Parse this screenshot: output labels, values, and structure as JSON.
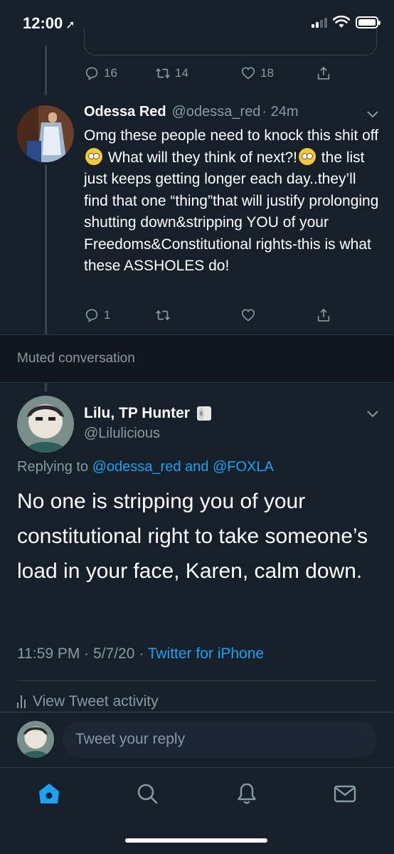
{
  "status_bar": {
    "time": "12:00"
  },
  "previous_tweet_actions": {
    "replies": "16",
    "retweets": "14",
    "likes": "18"
  },
  "reply_tweet": {
    "name": "Odessa Red",
    "handle": "@odessa_red",
    "time": "· 24m",
    "text_1": "Omg these people need to knock this shit off",
    "text_2": " What will they think of next?!",
    "text_3": " the list just keeps getting longer each day..they’ll find that one “thing”that will justify prolonging shutting down&stripping YOU of your Freedoms&Constitutional rights-this is what these ASSHOLES do!",
    "replies": "1"
  },
  "muted_label": "Muted conversation",
  "main_tweet": {
    "name": "Lilu, TP Hunter",
    "handle": "@Lilulicious",
    "replying_prefix": "Replying to",
    "replying_user_1": "@odessa_red",
    "replying_and": "and",
    "replying_user_2": "@FOXLA",
    "text": "No one is stripping you of your constitutional right to take someone’s load in your face, Karen, calm down.",
    "time": "11:59 PM",
    "date": "5/7/20",
    "source": "Twitter for iPhone",
    "activity_label": "View Tweet activity"
  },
  "composer": {
    "placeholder": "Tweet your reply"
  },
  "colors": {
    "background": "#15202b",
    "accent": "#1da1f2",
    "secondary_text": "#8899a6",
    "divider": "#38444d"
  }
}
